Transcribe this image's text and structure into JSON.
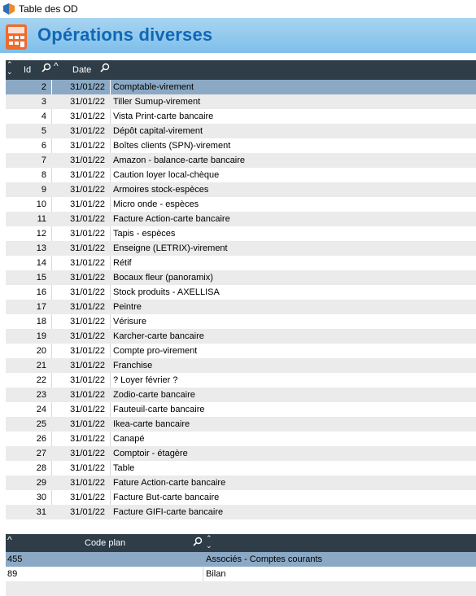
{
  "window": {
    "title": "Table des OD"
  },
  "header": {
    "title": "Opérations diverses"
  },
  "table1": {
    "columns": {
      "id": "Id",
      "date": "Date"
    },
    "rows": [
      {
        "id": "2",
        "date": "31/01/22",
        "label": "Comptable-virement"
      },
      {
        "id": "3",
        "date": "31/01/22",
        "label": "Tiller Sumup-virement"
      },
      {
        "id": "4",
        "date": "31/01/22",
        "label": "Vista Print-carte bancaire"
      },
      {
        "id": "5",
        "date": "31/01/22",
        "label": "Dépôt capital-virement"
      },
      {
        "id": "6",
        "date": "31/01/22",
        "label": "Boîtes clients (SPN)-virement"
      },
      {
        "id": "7",
        "date": "31/01/22",
        "label": "Amazon - balance-carte bancaire"
      },
      {
        "id": "8",
        "date": "31/01/22",
        "label": "Caution loyer local-chèque"
      },
      {
        "id": "9",
        "date": "31/01/22",
        "label": "Armoires stock-espèces"
      },
      {
        "id": "10",
        "date": "31/01/22",
        "label": "Micro onde - espèces"
      },
      {
        "id": "11",
        "date": "31/01/22",
        "label": "Facture Action-carte bancaire"
      },
      {
        "id": "12",
        "date": "31/01/22",
        "label": "Tapis - espèces"
      },
      {
        "id": "13",
        "date": "31/01/22",
        "label": "Enseigne (LETRIX)-virement"
      },
      {
        "id": "14",
        "date": "31/01/22",
        "label": "Rétif"
      },
      {
        "id": "15",
        "date": "31/01/22",
        "label": "Bocaux fleur (panoramix)"
      },
      {
        "id": "16",
        "date": "31/01/22",
        "label": "Stock produits - AXELLISA"
      },
      {
        "id": "17",
        "date": "31/01/22",
        "label": "Peintre"
      },
      {
        "id": "18",
        "date": "31/01/22",
        "label": "Vérisure"
      },
      {
        "id": "19",
        "date": "31/01/22",
        "label": "Karcher-carte bancaire"
      },
      {
        "id": "20",
        "date": "31/01/22",
        "label": "Compte pro-virement"
      },
      {
        "id": "21",
        "date": "31/01/22",
        "label": "Franchise"
      },
      {
        "id": "22",
        "date": "31/01/22",
        "label": "? Loyer février ?"
      },
      {
        "id": "23",
        "date": "31/01/22",
        "label": "Zodio-carte bancaire"
      },
      {
        "id": "24",
        "date": "31/01/22",
        "label": "Fauteuil-carte bancaire"
      },
      {
        "id": "25",
        "date": "31/01/22",
        "label": "Ikea-carte bancaire"
      },
      {
        "id": "26",
        "date": "31/01/22",
        "label": "Canapé"
      },
      {
        "id": "27",
        "date": "31/01/22",
        "label": "Comptoir - étagère"
      },
      {
        "id": "28",
        "date": "31/01/22",
        "label": "Table"
      },
      {
        "id": "29",
        "date": "31/01/22",
        "label": "Fature Action-carte bancaire"
      },
      {
        "id": "30",
        "date": "31/01/22",
        "label": "Facture But-carte bancaire"
      },
      {
        "id": "31",
        "date": "31/01/22",
        "label": "Facture GIFI-carte bancaire"
      }
    ]
  },
  "table2": {
    "columns": {
      "code": "Code plan"
    },
    "rows": [
      {
        "code": "455",
        "label": "Associés - Comptes courants"
      },
      {
        "code": "89",
        "label": "Bilan"
      },
      {
        "code": "",
        "label": ""
      }
    ]
  },
  "colors": {
    "header_bg": "#2e3d47",
    "selected_row": "#8ba9c4",
    "banner": "#7ebfea",
    "title": "#1167b5"
  }
}
